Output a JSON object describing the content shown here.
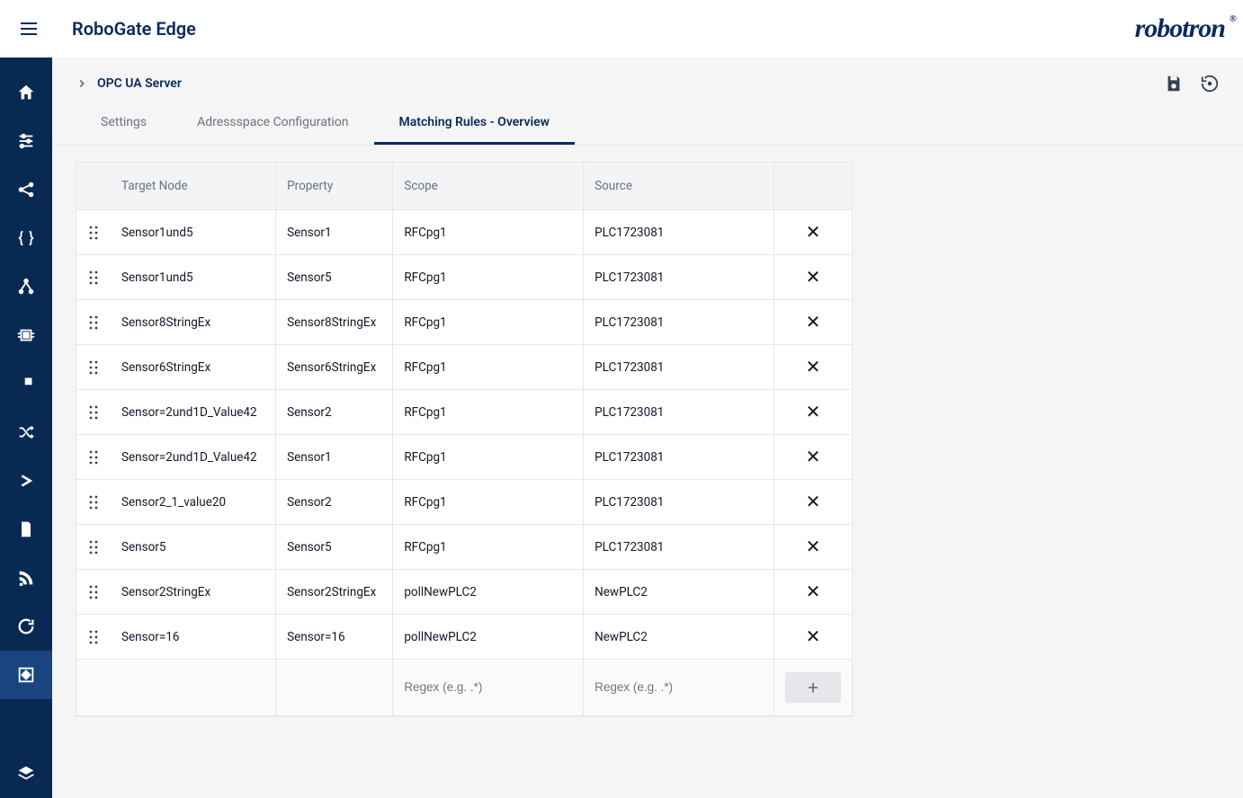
{
  "app_title": "RoboGate Edge",
  "brand": "robotron",
  "breadcrumb": {
    "title": "OPC UA Server"
  },
  "tabs": [
    {
      "label": "Settings",
      "active": false
    },
    {
      "label": "Adressspace Configuration",
      "active": false
    },
    {
      "label": "Matching Rules - Overview",
      "active": true
    }
  ],
  "table": {
    "headers": {
      "target_node": "Target Node",
      "property": "Property",
      "scope": "Scope",
      "source": "Source"
    },
    "rows": [
      {
        "target_node": "Sensor1und5",
        "property": "Sensor1",
        "scope": "RFCpg1",
        "source": "PLC1723081"
      },
      {
        "target_node": "Sensor1und5",
        "property": "Sensor5",
        "scope": "RFCpg1",
        "source": "PLC1723081"
      },
      {
        "target_node": "Sensor8StringEx",
        "property": "Sensor8StringEx",
        "scope": "RFCpg1",
        "source": "PLC1723081"
      },
      {
        "target_node": "Sensor6StringEx",
        "property": "Sensor6StringEx",
        "scope": "RFCpg1",
        "source": "PLC1723081"
      },
      {
        "target_node": "Sensor=2und1D_Value42",
        "property": "Sensor2",
        "scope": "RFCpg1",
        "source": "PLC1723081"
      },
      {
        "target_node": "Sensor=2und1D_Value42",
        "property": "Sensor1",
        "scope": "RFCpg1",
        "source": "PLC1723081"
      },
      {
        "target_node": "Sensor2_1_value20",
        "property": "Sensor2",
        "scope": "RFCpg1",
        "source": "PLC1723081"
      },
      {
        "target_node": "Sensor5",
        "property": "Sensor5",
        "scope": "RFCpg1",
        "source": "PLC1723081"
      },
      {
        "target_node": "Sensor2StringEx",
        "property": "Sensor2StringEx",
        "scope": "pollNewPLC2",
        "source": "NewPLC2"
      },
      {
        "target_node": "Sensor=16",
        "property": "Sensor=16",
        "scope": "pollNewPLC2",
        "source": "NewPLC2"
      }
    ],
    "footer": {
      "scope_placeholder": "Regex (e.g. .*)",
      "source_placeholder": "Regex (e.g. .*)"
    }
  },
  "colors": {
    "brand_navy": "#082952",
    "accent": "#0a2b5c"
  }
}
